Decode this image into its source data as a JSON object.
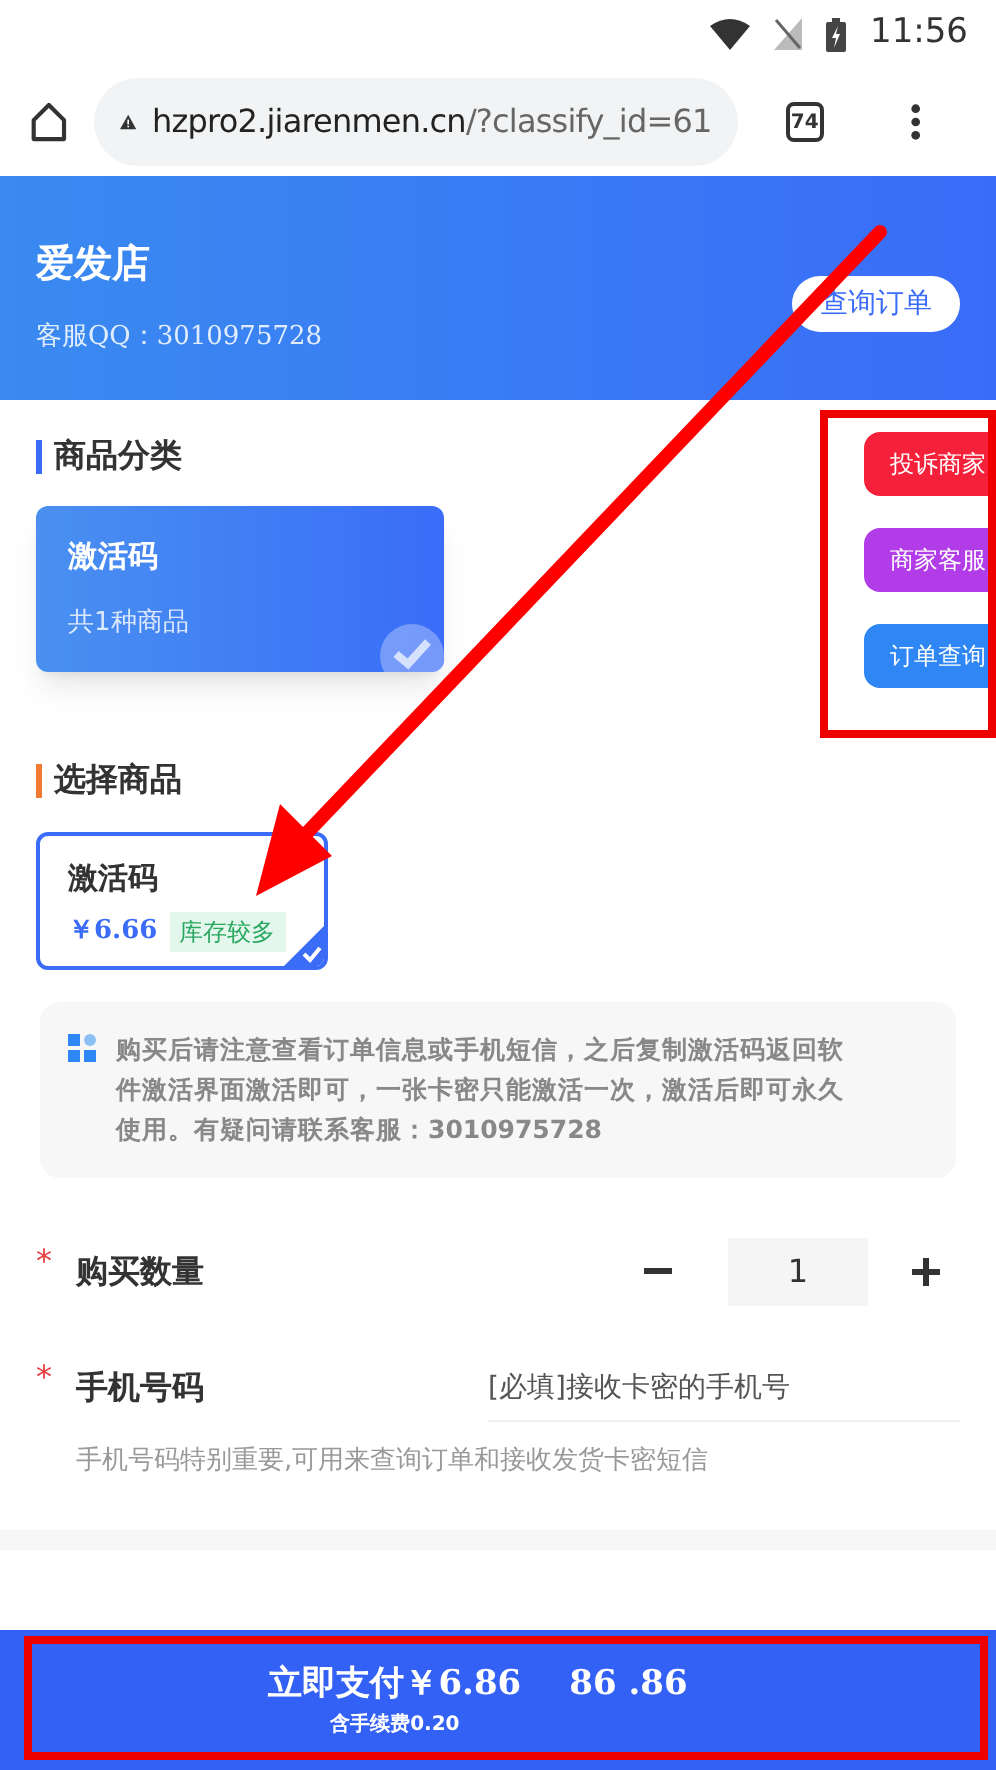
{
  "status_bar": {
    "time": "11:56"
  },
  "browser": {
    "url_host": "hzpro2.jiarenmen.cn",
    "url_path": "/?classify_id=61",
    "tab_count": "74"
  },
  "shop": {
    "name": "爱发店",
    "qq": "客服QQ：3010975728",
    "query_button": "查询订单"
  },
  "floating_buttons": [
    {
      "label": "投诉商家",
      "color": "#f5213a"
    },
    {
      "label": "商家客服",
      "color": "#b13ce8"
    },
    {
      "label": "订单查询",
      "color": "#2f86f5"
    }
  ],
  "category": {
    "title": "商品分类",
    "items": [
      {
        "name": "激活码",
        "count": "共1种商品",
        "selected": true
      }
    ]
  },
  "products": {
    "title": "选择商品",
    "items": [
      {
        "name": "激活码",
        "price": "￥6.66",
        "stock": "库存较多",
        "selected": true
      }
    ]
  },
  "notice": "购买后请注意查看订单信息或手机短信，之后复制激活码返回软件激活界面激活即可，一张卡密只能激活一次，激活后即可永久使用。有疑问请联系客服：3010975728",
  "quantity": {
    "required_mark": "*",
    "label": "购买数量",
    "value": "1"
  },
  "phone": {
    "required_mark": "*",
    "label": "手机号码",
    "placeholder": "[必填]接收卡密的手机号",
    "hint": "手机号码特别重要,可用来查询订单和接收发货卡密短信"
  },
  "pay_bar": {
    "label": "立即支付￥6.86",
    "fee": "含手续费0.20",
    "ghost_text": "86 .86"
  }
}
